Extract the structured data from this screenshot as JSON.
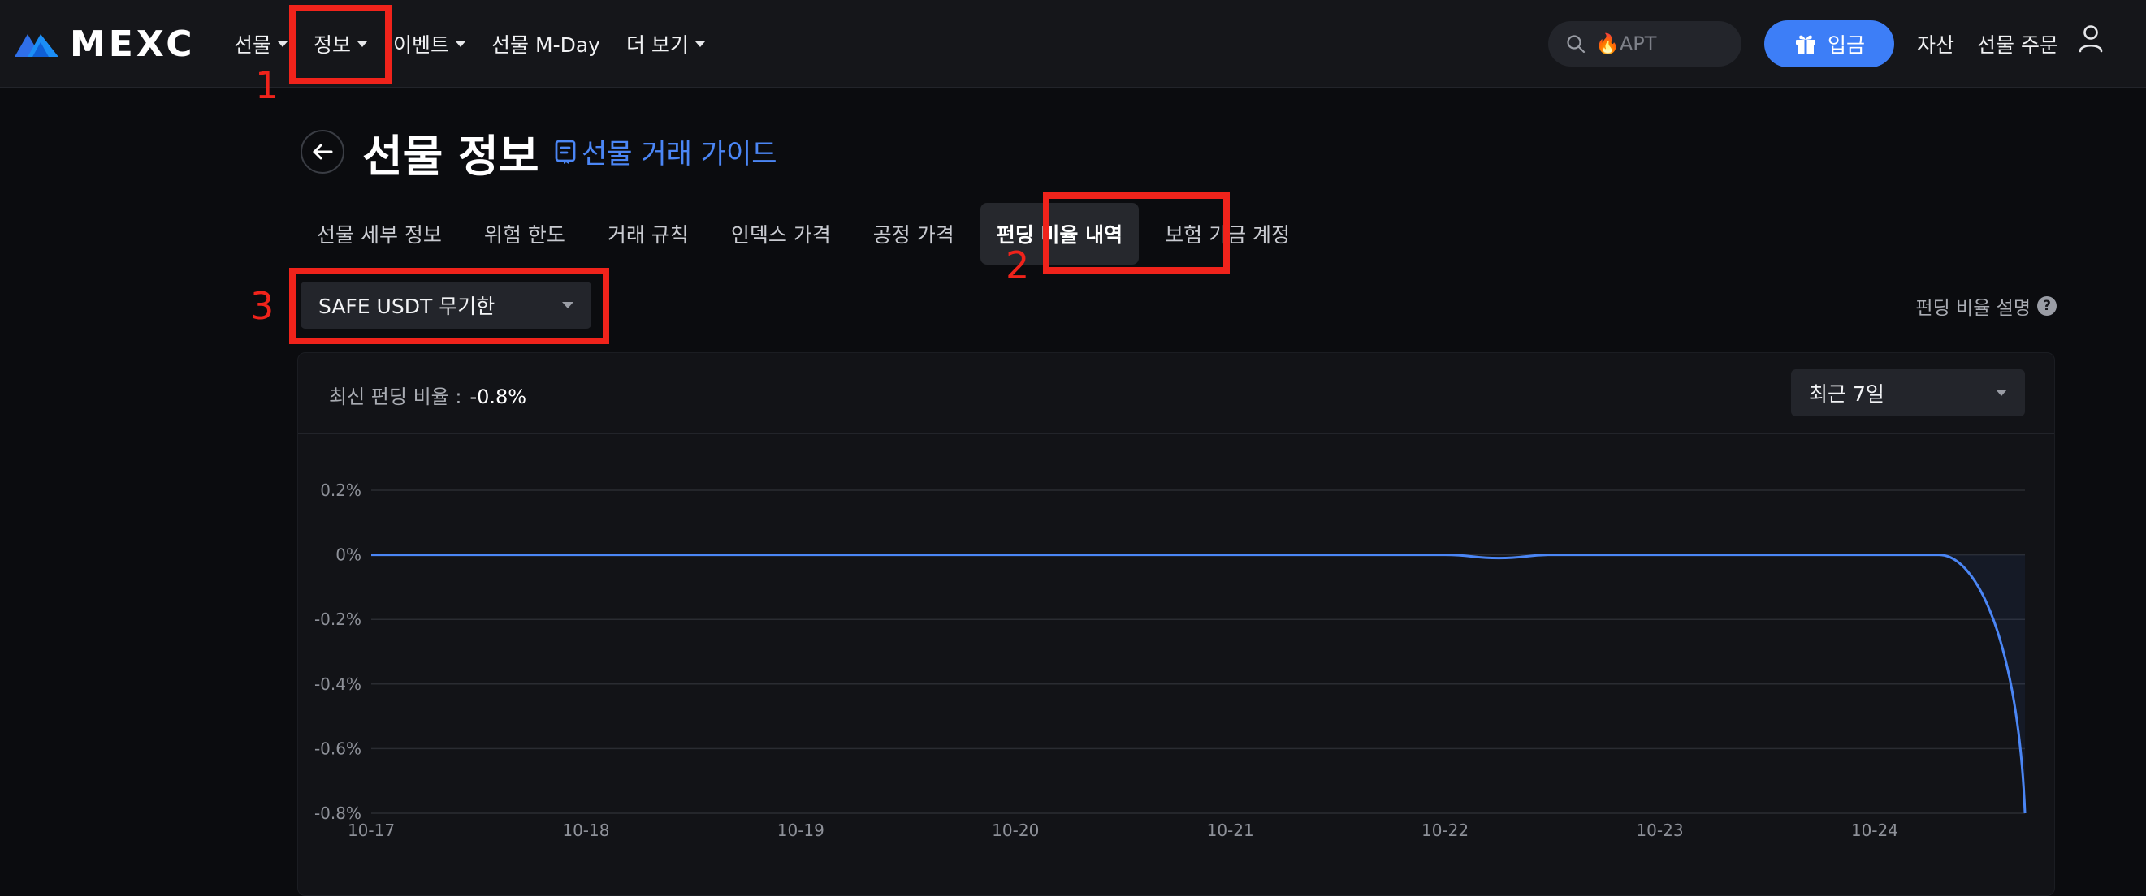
{
  "brand": {
    "name": "MEXC"
  },
  "nav": {
    "items": [
      {
        "label": "선물",
        "has_caret": true
      },
      {
        "label": "정보",
        "has_caret": true
      },
      {
        "label": "이벤트",
        "has_caret": true
      },
      {
        "label": "선물 M-Day",
        "has_caret": false
      },
      {
        "label": "더 보기",
        "has_caret": true
      }
    ]
  },
  "search": {
    "placeholder": "🔥APT",
    "icon": "search-icon"
  },
  "header_actions": {
    "deposit_label": "입금",
    "assets_label": "자산",
    "futures_orders_label": "선물 주문",
    "user_icon": "user-icon"
  },
  "annotations": [
    {
      "number": "1",
      "target": "nav-정보"
    },
    {
      "number": "2",
      "target": "tab-펀딩 비율 내역"
    },
    {
      "number": "3",
      "target": "symbol-select"
    }
  ],
  "page": {
    "title": "선물 정보",
    "guide_link": "선물 거래 가이드"
  },
  "tabs": [
    {
      "label": "선물 세부 정보",
      "active": false
    },
    {
      "label": "위험 한도",
      "active": false
    },
    {
      "label": "거래 규칙",
      "active": false
    },
    {
      "label": "인덱스 가격",
      "active": false
    },
    {
      "label": "공정 가격",
      "active": false
    },
    {
      "label": "펀딩 비율 내역",
      "active": true
    },
    {
      "label": "보험 기금 계정",
      "active": false
    }
  ],
  "symbol_select": {
    "value": "SAFE USDT 무기한"
  },
  "funding_explain": {
    "label": "펀딩 비율 설명",
    "icon": "help-icon"
  },
  "panel": {
    "latest_label": "최신 펀딩 비율 :",
    "latest_value": "-0.8%",
    "range_value": "최근 7일"
  },
  "colors": {
    "accent": "#3d7ef7",
    "line": "#4b86f5",
    "annotation": "#f0231b",
    "background": "#0b0c0f"
  },
  "chart_data": {
    "type": "line",
    "title": "",
    "xlabel": "",
    "ylabel": "",
    "y_ticks": [
      "0.2%",
      "0%",
      "-0.2%",
      "-0.4%",
      "-0.6%",
      "-0.8%"
    ],
    "y_tick_values": [
      0.2,
      0,
      -0.2,
      -0.4,
      -0.6,
      -0.8
    ],
    "ylim": [
      -0.8,
      0.2
    ],
    "x_ticks": [
      "10-17",
      "10-18",
      "10-19",
      "10-20",
      "10-21",
      "10-22",
      "10-23",
      "10-24"
    ],
    "xlim_days": [
      0,
      7.7
    ],
    "grid": true,
    "series": [
      {
        "points": [
          {
            "x": 0.0,
            "y": 0.0
          },
          {
            "x": 1.0,
            "y": 0.0
          },
          {
            "x": 2.0,
            "y": 0.0
          },
          {
            "x": 3.0,
            "y": 0.0
          },
          {
            "x": 4.0,
            "y": 0.0
          },
          {
            "x": 5.0,
            "y": 0.0
          },
          {
            "x": 5.25,
            "y": -0.01
          },
          {
            "x": 5.5,
            "y": 0.0
          },
          {
            "x": 6.0,
            "y": 0.0
          },
          {
            "x": 7.0,
            "y": 0.0
          },
          {
            "x": 7.3,
            "y": 0.0
          },
          {
            "x": 7.7,
            "y": -0.8
          }
        ]
      }
    ]
  }
}
